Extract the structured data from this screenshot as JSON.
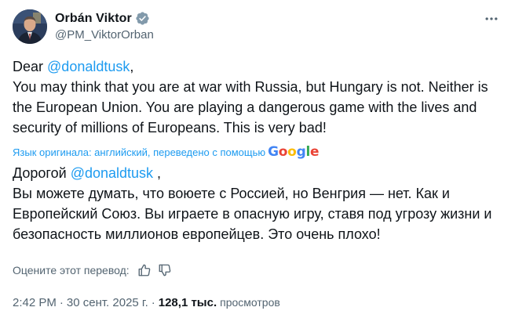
{
  "author": {
    "display_name": "Orbán Viktor",
    "handle": "@PM_ViktorOrban",
    "verified_icon": "verified-badge-icon",
    "avatar_icon": "avatar-photo"
  },
  "more_icon": "more-horizontal-icon",
  "tweet": {
    "greeting_prefix": "Dear",
    "mention": "@donaldtusk",
    "greeting_suffix": ",",
    "body": "You may think that you are at war with Russia, but Hungary is not. Neither is the European Union. You are playing a dangerous game with the lives and security of millions of Europeans. This is very bad!"
  },
  "translation": {
    "attribution": "Язык оригинала: английский, переведено с помощью",
    "provider": "Google",
    "greeting_prefix": "Дорогой",
    "mention": "@donaldtusk",
    "greeting_suffix": " ,",
    "body": "Вы можете думать, что воюете с Россией, но Венгрия — нет. Как и Европейский Союз. Вы играете в опасную игру, ставя под угрозу жизни и безопасность миллионов европейцев. Это очень плохо!",
    "rate_label": "Оцените этот перевод:",
    "thumbs_up_icon": "thumbs-up-icon",
    "thumbs_down_icon": "thumbs-down-icon"
  },
  "meta": {
    "time": "2:42 PM",
    "separator": "·",
    "date": "30 сент. 2025 г.",
    "views_count": "128,1 тыс.",
    "views_label": "просмотров"
  },
  "colors": {
    "link": "#1d9bf0",
    "text": "#0f1419",
    "secondary": "#536471",
    "google_blue": "#4285F4",
    "google_red": "#EA4335",
    "google_yellow": "#FBBC05",
    "google_green": "#34A853"
  }
}
